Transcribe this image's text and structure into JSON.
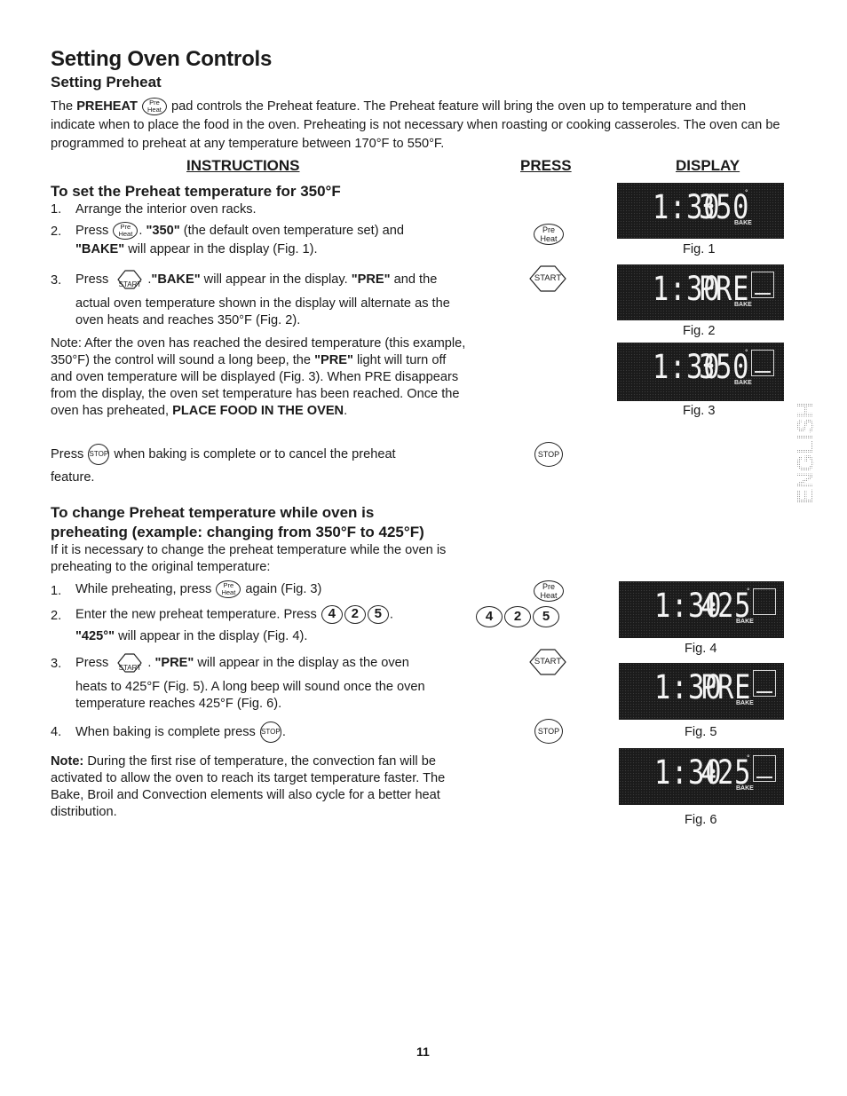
{
  "page": {
    "title": "Setting Oven Controls",
    "subtitle": "Setting Preheat",
    "intro": {
      "part1": "The ",
      "bold1": "PREHEAT",
      "part2": " pad controls the Preheat feature. The Preheat feature will bring the oven up to temperature and then indicate when to place the food in the oven. Preheating is not necessary when roasting or cooking casseroles. The oven can be programmed to preheat at any temperature between 170°F to 550°F."
    },
    "columns": {
      "instructions": "INSTRUCTIONS",
      "press": "PRESS",
      "display": "DISPLAY"
    },
    "side_tab": "ENGLISH",
    "page_number": "11"
  },
  "keys": {
    "preheat_top": "Pre",
    "preheat_bottom": "Heat",
    "start": "START",
    "stop": "STOP",
    "digits": [
      "4",
      "2",
      "5"
    ]
  },
  "section1": {
    "heading": "To set the Preheat temperature for 350°F",
    "steps": [
      {
        "num": "1.",
        "text": "Arrange the interior oven racks."
      },
      {
        "num": "2.",
        "pre": "Press ",
        "b1": "\"350\"",
        "mid": " (the default oven temperature set) and",
        "b2": "\"BAKE\"",
        "post": " will appear in the display (Fig. 1)."
      },
      {
        "num": "3.",
        "pre": "Press ",
        "b1": "\"BAKE\"",
        "mid": " will appear in the display. ",
        "b2": "\"PRE\"",
        "post": " and the",
        "cont": "actual oven temperature shown in the display will alternate as the oven heats and reaches 350°F (Fig. 2)."
      }
    ],
    "note": {
      "p1": "Note: After the oven has reached the desired temperature (this example, 350°F) the control will sound a long beep, the ",
      "b1": "\"PRE\"",
      "p2": " light will turn off and oven temperature will be displayed (Fig. 3). When PRE disappears from the display, the oven set temperature has been reached. Once the oven has preheated, ",
      "b2": "PLACE FOOD IN THE OVEN",
      "p3": "."
    },
    "stop_line": {
      "pre": "Press ",
      "post": " when baking is complete or to cancel the preheat",
      "cont": "feature."
    }
  },
  "section2": {
    "heading_line1": "To change Preheat temperature while oven is",
    "heading_line2": "preheating (example: changing from 350°F to 425°F)",
    "intro": "If it is necessary to change the preheat temperature while the oven is preheating to the original temperature:",
    "steps": [
      {
        "num": "1.",
        "pre": "While preheating, press ",
        "post": " again (Fig. 3)"
      },
      {
        "num": "2.",
        "pre": "Enter the new preheat temperature. Press ",
        "post": ".",
        "b1": "\"425°\"",
        "cont": " will appear in the display (Fig. 4)."
      },
      {
        "num": "3.",
        "pre": "Press ",
        "b1": "\"PRE\"",
        "post": " will appear in the display as the oven",
        "cont": "heats to 425°F (Fig. 5). A long beep will sound once the oven temperature reaches 425°F (Fig. 6)."
      },
      {
        "num": "4.",
        "pre": "When baking is complete press ",
        "post": "."
      }
    ],
    "note": {
      "label": "Note:",
      "text": " During the first rise of temperature, the convection fan will be activated to allow the oven to reach its target temperature faster. The Bake, Broil and Convection elements will also cycle for a better heat distribution."
    }
  },
  "displays": [
    {
      "fig": "Fig. 1",
      "time": "1:30",
      "value": "350",
      "degree": "°",
      "mode": "BAKE",
      "indicator": "none"
    },
    {
      "fig": "Fig. 2",
      "time": "1:30",
      "value": "PRE",
      "degree": "",
      "mode": "BAKE",
      "indicator": "line"
    },
    {
      "fig": "Fig. 3",
      "time": "1:30",
      "value": "350",
      "degree": "°",
      "mode": "BAKE",
      "indicator": "line"
    },
    {
      "fig": "Fig. 4",
      "time": "1:30",
      "value": "425",
      "degree": "°",
      "mode": "BAKE",
      "indicator": "empty"
    },
    {
      "fig": "Fig. 5",
      "time": "1:30",
      "value": "PRE",
      "degree": "",
      "mode": "BAKE",
      "indicator": "line"
    },
    {
      "fig": "Fig. 6",
      "time": "1:30",
      "value": "425",
      "degree": "°",
      "mode": "BAKE",
      "indicator": "line"
    }
  ]
}
